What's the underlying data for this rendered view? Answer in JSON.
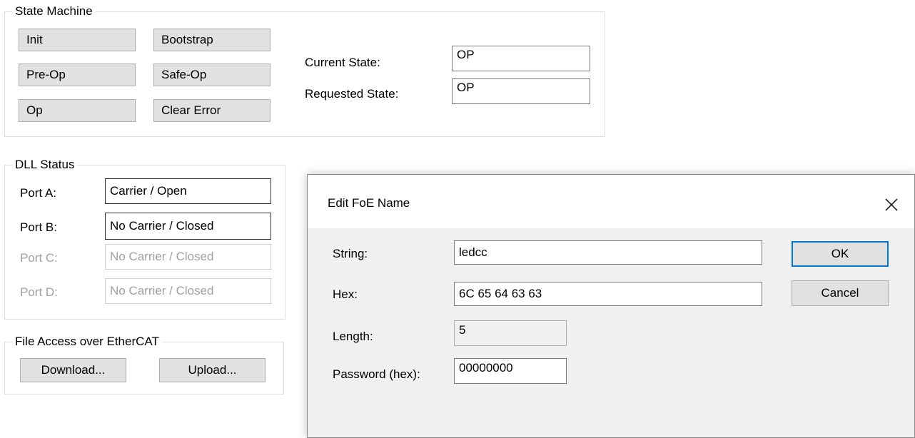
{
  "state_machine": {
    "title": "State Machine",
    "buttons": [
      "Init",
      "Bootstrap",
      "Pre-Op",
      "Safe-Op",
      "Op",
      "Clear Error"
    ],
    "current_state_label": "Current State:",
    "current_state_value": "OP",
    "requested_state_label": "Requested State:",
    "requested_state_value": "OP"
  },
  "dll_status": {
    "title": "DLL Status",
    "ports": [
      {
        "label": "Port A:",
        "value": "Carrier / Open"
      },
      {
        "label": "Port B:",
        "value": "No Carrier / Closed"
      },
      {
        "label": "Port C:",
        "value": "No Carrier / Closed"
      },
      {
        "label": "Port D:",
        "value": "No Carrier / Closed"
      }
    ]
  },
  "foe": {
    "title": "File Access over EtherCAT",
    "download_label": "Download...",
    "upload_label": "Upload..."
  },
  "dialog": {
    "title": "Edit FoE Name",
    "close_icon": "close-icon",
    "string_label": "String:",
    "string_value": "ledcc",
    "hex_label": "Hex:",
    "hex_value": "6C 65 64 63 63",
    "length_label": "Length:",
    "length_value": "5",
    "password_label": "Password (hex):",
    "password_value": "00000000",
    "ok_label": "OK",
    "cancel_label": "Cancel"
  }
}
